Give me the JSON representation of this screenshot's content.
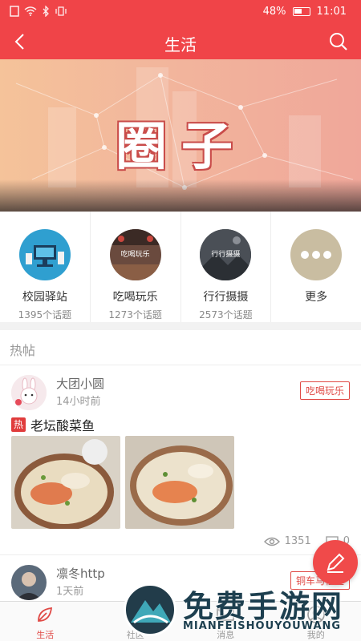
{
  "status_bar": {
    "battery": "48%",
    "time": "11:01"
  },
  "header": {
    "title": "生活"
  },
  "banner": {
    "text": "圈子"
  },
  "categories": [
    {
      "name": "校园驿站",
      "count": "1395个话题",
      "icon_label": ""
    },
    {
      "name": "吃喝玩乐",
      "count": "1273个话题",
      "icon_label": "吃喝玩乐"
    },
    {
      "name": "行行摄摄",
      "count": "2573个话题",
      "icon_label": "行行摄摄"
    },
    {
      "name": "更多",
      "count": "",
      "icon_label": ""
    }
  ],
  "section": {
    "title": "热帖"
  },
  "posts": [
    {
      "author": "大团小圆",
      "time": "14小时前",
      "tag": "吃喝玩乐",
      "hot_badge": "热",
      "title": "老坛酸菜鱼",
      "views": "1351",
      "comments": "0"
    },
    {
      "author": "凛冬http",
      "time": "1天前",
      "tag": "铜车马社区"
    }
  ],
  "tabbar": [
    {
      "label": "生活",
      "icon": "leaf-icon",
      "active": true
    },
    {
      "label": "社区",
      "icon": "community-icon"
    },
    {
      "label": "消息",
      "icon": "mail-icon"
    },
    {
      "label": "我的",
      "icon": "profile-icon"
    }
  ],
  "watermark": {
    "title": "免费手游网",
    "subtitle": "MIANFEISHOUYOUWANG"
  },
  "colors": {
    "brand": "#f04448",
    "tag_red": "#e04a46"
  }
}
